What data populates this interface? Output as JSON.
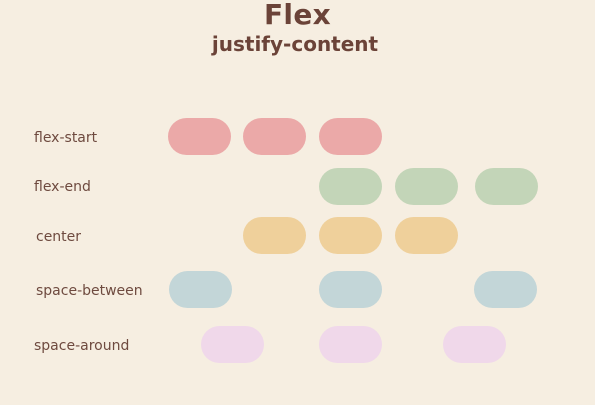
{
  "title": "Flex",
  "subtitle": "justify-content",
  "rows": [
    {
      "label": "flex-start",
      "color": "#eba9a8",
      "items": 3
    },
    {
      "label": "flex-end",
      "color": "#c3d5b8",
      "items": 3
    },
    {
      "label": "center",
      "color": "#efd09b",
      "items": 3
    },
    {
      "label": "space-between",
      "color": "#c3d6d8",
      "items": 3
    },
    {
      "label": "space-around",
      "color": "#f0d8ea",
      "items": 3
    }
  ]
}
